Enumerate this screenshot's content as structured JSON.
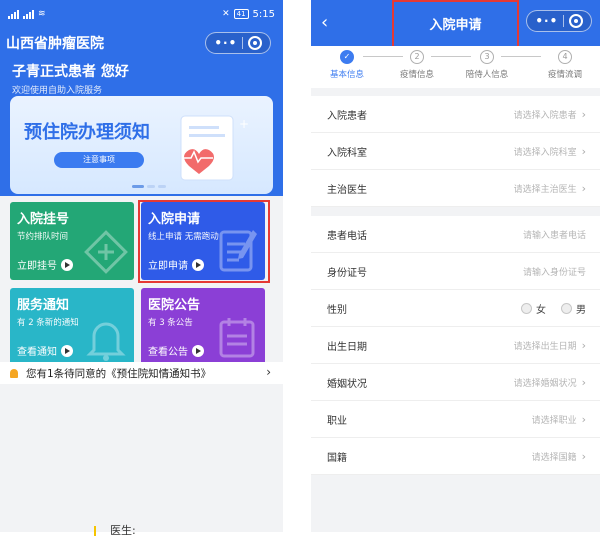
{
  "left": {
    "status_time": "5:15",
    "battery": "41",
    "hospital_name": "山西省肿瘤医院",
    "greeting": "子青正式患者 您好",
    "greeting_sub": "欢迎使用自助入院服务",
    "banner": {
      "title": "预住院办理须知",
      "tag": "注意事项"
    },
    "cards": [
      {
        "title": "入院挂号",
        "subtitle": "节约排队时间",
        "action": "立即挂号",
        "color": "#23a776"
      },
      {
        "title": "入院申请",
        "subtitle": "线上申请 无需跑动",
        "action": "立即申请",
        "color": "#2f5be8"
      },
      {
        "title": "服务通知",
        "subtitle": "有 2 条新的通知",
        "action": "查看通知",
        "color": "#29b6c8"
      },
      {
        "title": "医院公告",
        "subtitle": "有 3 条公告",
        "action": "查看公告",
        "color": "#8b3fd6"
      }
    ],
    "notice": "您有1条待同意的《预住院知情通知书》"
  },
  "right": {
    "title": "入院申请",
    "steps": [
      {
        "num": "",
        "label": "基本信息"
      },
      {
        "num": "2",
        "label": "疫情信息"
      },
      {
        "num": "3",
        "label": "陪侍人信息"
      },
      {
        "num": "4",
        "label": "疫情流调"
      }
    ],
    "group1": [
      {
        "label": "入院患者",
        "placeholder": "请选择入院患者"
      },
      {
        "label": "入院科室",
        "placeholder": "请选择入院科室"
      },
      {
        "label": "主治医生",
        "placeholder": "请选择主治医生"
      }
    ],
    "phone": {
      "label": "患者电话",
      "placeholder": "请输入患者电话"
    },
    "idcard": {
      "label": "身份证号",
      "placeholder": "请输入身份证号"
    },
    "gender": {
      "label": "性别",
      "female": "女",
      "male": "男"
    },
    "group3": [
      {
        "label": "出生日期",
        "placeholder": "请选择出生日期"
      },
      {
        "label": "婚姻状况",
        "placeholder": "请选择婚姻状况"
      },
      {
        "label": "职业",
        "placeholder": "请选择职业"
      },
      {
        "label": "国籍",
        "placeholder": "请选择国籍"
      }
    ]
  },
  "bottom_caption": "医生:"
}
